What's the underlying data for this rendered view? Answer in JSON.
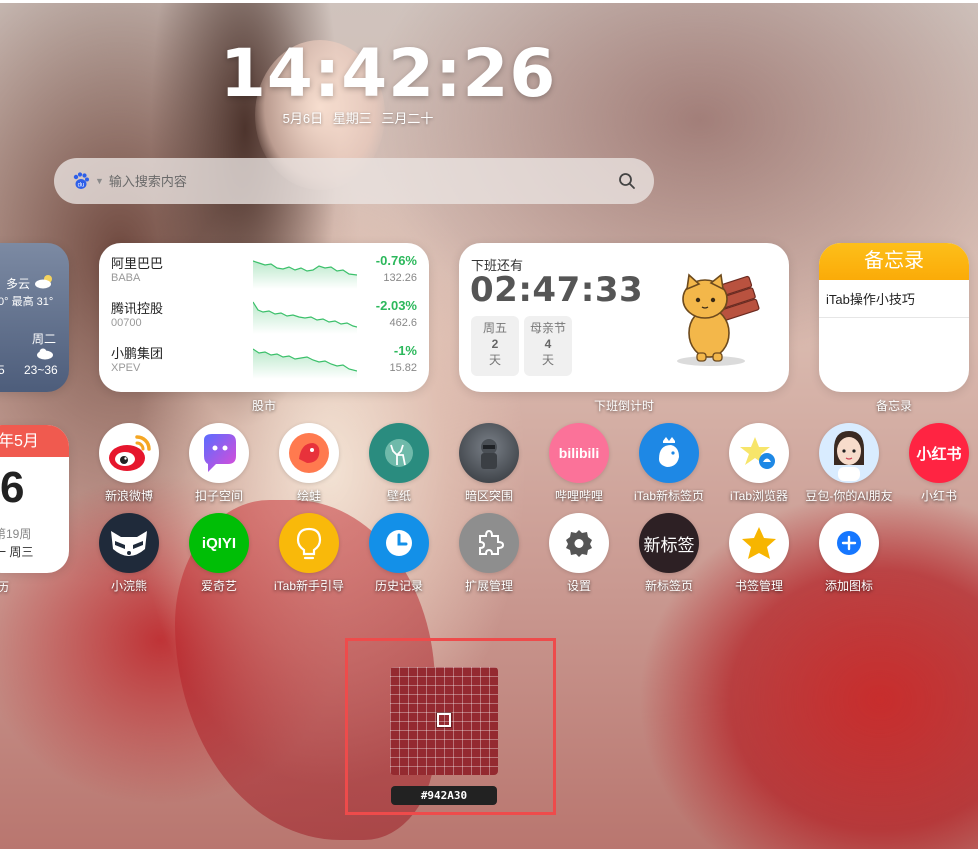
{
  "clock": {
    "time": "14:42:26",
    "date": "5月6日",
    "weekday": "星期三",
    "lunar": "三月二十"
  },
  "search": {
    "placeholder": "输入搜索内容",
    "engine_icon": "baidu-icon",
    "search_icon": "magnifier-icon"
  },
  "weather": {
    "condition": "多云",
    "range": "0° 最高 31°",
    "day": "周二",
    "day_range": "23~36",
    "left_digit": "5"
  },
  "stocks": {
    "caption": "股市",
    "items": [
      {
        "name": "阿里巴巴",
        "code": "BABA",
        "change": "-0.76%",
        "price": "132.26"
      },
      {
        "name": "腾讯控股",
        "code": "00700",
        "change": "-2.03%",
        "price": "462.6"
      },
      {
        "name": "小鹏集团",
        "code": "XPEV",
        "change": "-1%",
        "price": "15.82"
      }
    ],
    "change_color": "#2cb85c"
  },
  "offwork": {
    "caption": "下班倒计时",
    "title": "下班还有",
    "countdown": "02:47:33",
    "boxes": [
      {
        "label": "周五",
        "num": "2",
        "unit": "天"
      },
      {
        "label": "母亲节",
        "num": "4",
        "unit": "天"
      }
    ]
  },
  "memo": {
    "caption": "备忘录",
    "title": "备忘录",
    "line": "iTab操作小技巧",
    "accent": "#fbb30f"
  },
  "calendar": {
    "month": "年5月",
    "day": "6",
    "week": "第19周",
    "weekday": "一 周三",
    "caption": "历"
  },
  "apps_row1": [
    {
      "label": "新浪微博",
      "icon": "weibo-icon"
    },
    {
      "label": "扣子空间",
      "icon": "coze-icon"
    },
    {
      "label": "绘蛙",
      "icon": "huiwa-icon"
    },
    {
      "label": "壁纸",
      "icon": "deer-wallpaper-icon"
    },
    {
      "label": "暗区突围",
      "icon": "arena-breakout-icon"
    },
    {
      "label": "哔哩哔哩",
      "icon": "bilibili-icon",
      "text": "bilibili"
    },
    {
      "label": "iTab新标签页",
      "icon": "itab-bird-icon"
    },
    {
      "label": "iTab浏览器",
      "icon": "itab-browser-icon"
    },
    {
      "label": "豆包-你的AI朋友",
      "icon": "doubao-icon"
    },
    {
      "label": "小红书",
      "icon": "xiaohongshu-icon",
      "text": "小红书"
    }
  ],
  "apps_row2": [
    {
      "label": "小浣熊",
      "icon": "raccoon-icon"
    },
    {
      "label": "爱奇艺",
      "icon": "iqiyi-icon",
      "text": "iQIYI"
    },
    {
      "label": "iTab新手引导",
      "icon": "lightbulb-icon"
    },
    {
      "label": "历史记录",
      "icon": "clock-icon"
    },
    {
      "label": "扩展管理",
      "icon": "puzzle-icon"
    },
    {
      "label": "设置",
      "icon": "gear-icon"
    },
    {
      "label": "新标签页",
      "icon": "new-tab-icon",
      "text": "新标签"
    },
    {
      "label": "书签管理",
      "icon": "star-icon"
    },
    {
      "label": "添加图标",
      "icon": "plus-icon"
    }
  ],
  "color_picker": {
    "hex": "#942A30",
    "color": "#942A30"
  }
}
